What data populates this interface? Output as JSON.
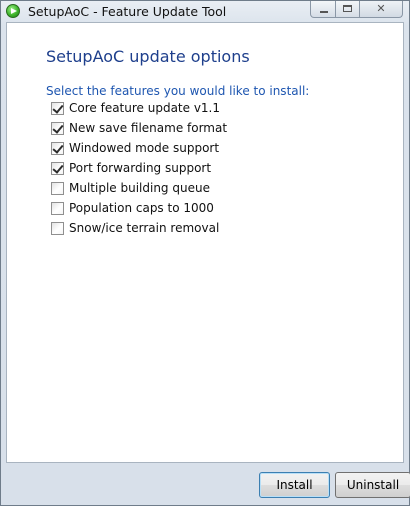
{
  "window": {
    "title": "SetupAoC - Feature Update Tool",
    "caption_buttons": {
      "minimize": "minimize-icon",
      "maximize": "maximize-icon",
      "close_glyph": "✕"
    }
  },
  "main": {
    "heading": "SetupAoC update options",
    "prompt": "Select the features you would like to install:",
    "features": [
      {
        "label": "Core feature update v1.1",
        "checked": true
      },
      {
        "label": "New save filename format",
        "checked": true
      },
      {
        "label": "Windowed mode support",
        "checked": true
      },
      {
        "label": "Port forwarding support",
        "checked": true
      },
      {
        "label": "Multiple building queue",
        "checked": false
      },
      {
        "label": "Population caps to 1000",
        "checked": false
      },
      {
        "label": "Snow/ice terrain removal",
        "checked": false
      }
    ]
  },
  "footer": {
    "install_label": "Install",
    "uninstall_label": "Uninstall"
  }
}
